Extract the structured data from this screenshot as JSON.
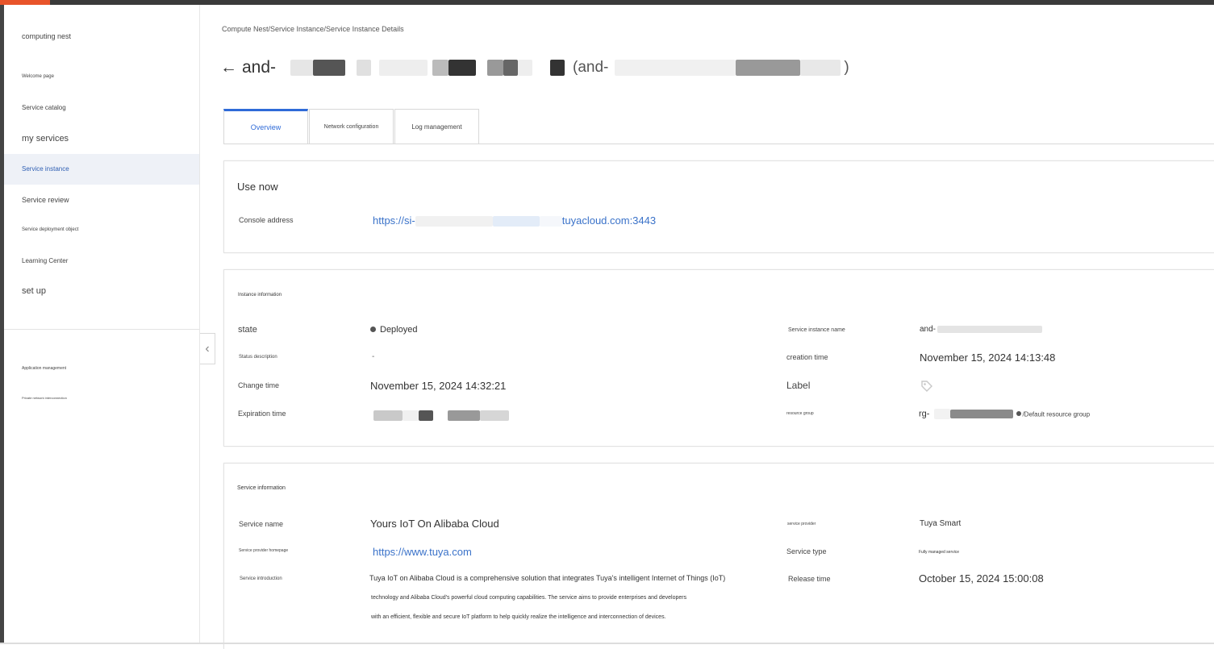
{
  "sidebar": {
    "product_title": "computing nest",
    "items": [
      {
        "label": "Welcome page"
      },
      {
        "label": "Service catalog"
      },
      {
        "label": "my services"
      },
      {
        "label": "Service instance"
      },
      {
        "label": "Service review"
      },
      {
        "label": "Service deployment object"
      },
      {
        "label": "Learning Center"
      },
      {
        "label": "set up"
      }
    ],
    "secondary": [
      {
        "label": "Application management"
      },
      {
        "label": "Private network interconnection"
      }
    ]
  },
  "breadcrumb": "Compute Nest/Service Instance/Service Instance Details",
  "title": {
    "back_icon": "←",
    "name_prefix": "and-",
    "id_open": "(and-",
    "id_close": ")"
  },
  "tabs": [
    {
      "label": "Overview",
      "active": true
    },
    {
      "label": "Network configuration",
      "active": false
    },
    {
      "label": "Log management",
      "active": false
    }
  ],
  "use_now": {
    "title": "Use now",
    "console_label": "Console address",
    "console_prefix": "https://si-",
    "console_suffix": "tuyacloud.com:3443"
  },
  "instance_info": {
    "title": "Instance information",
    "state_label": "state",
    "state_value": "Deployed",
    "status_desc_label": "Status description",
    "status_desc_value": "-",
    "change_time_label": "Change time",
    "change_time_value": "November 15, 2024 14:32:21",
    "expiration_label": "Expiration time",
    "name_label": "Service instance name",
    "name_prefix": "and-",
    "creation_label": "creation time",
    "creation_value": "November 15, 2024 14:13:48",
    "label_label": "Label",
    "rg_label": "resource group",
    "rg_prefix": "rg-",
    "rg_default": "/Default resource group"
  },
  "service_info": {
    "title": "Service information",
    "name_label": "Service name",
    "name_value": "Yours IoT On Alibaba Cloud",
    "homepage_label": "Service provider homepage",
    "homepage_value": "https://www.tuya.com",
    "intro_label": "Service introduction",
    "intro_line1": "Tuya IoT on Alibaba Cloud is a comprehensive solution that integrates Tuya's intelligent Internet of Things (IoT)",
    "intro_line2": "technology and Alibaba Cloud's powerful cloud computing capabilities. The service aims to provide enterprises and developers",
    "intro_line3": "with an efficient, flexible and secure IoT platform to help quickly realize the intelligence and interconnection of devices.",
    "provider_label": "service provider",
    "provider_value": "Tuya Smart",
    "type_label": "Service type",
    "type_value": "Fully managed service",
    "release_label": "Release time",
    "release_value": "October 15, 2024 15:00:08"
  },
  "colors": {
    "accent": "#2f6bd8",
    "link": "#3a72c9",
    "active_nav_bg": "#eef1f7"
  }
}
